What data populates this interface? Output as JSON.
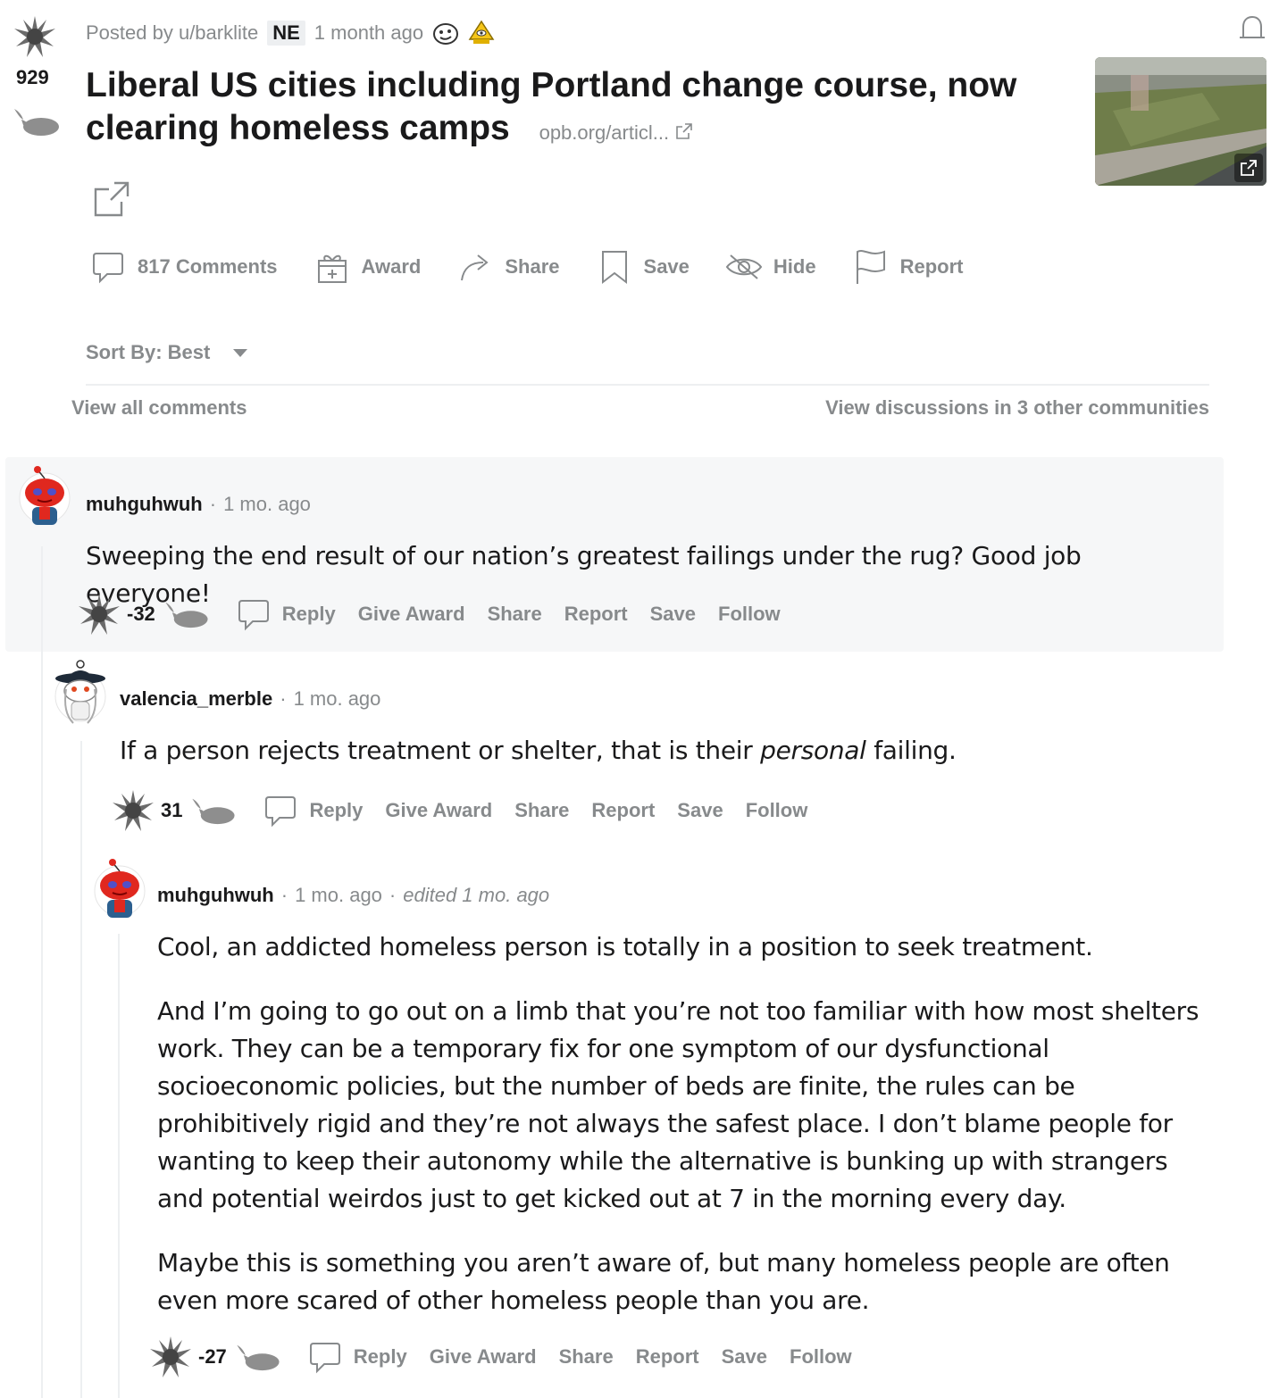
{
  "post": {
    "score": "929",
    "posted_by": "Posted by u/barklite",
    "flair": "NE",
    "time": "1 month ago",
    "title": "Liberal US cities including Portland change course, now clearing homeless camps",
    "domain": "opb.org/articl...",
    "icons": {
      "upvote": "burst-upvote-icon",
      "downvote": "whale-downvote-icon",
      "bell": "bell-icon",
      "expand": "external-link-icon"
    }
  },
  "actions": {
    "comments": "817 Comments",
    "award": "Award",
    "share": "Share",
    "save": "Save",
    "hide": "Hide",
    "report": "Report"
  },
  "sort": {
    "label": "Sort By: Best"
  },
  "links": {
    "view_all": "View all comments",
    "view_discussions": "View discussions in 3 other communities"
  },
  "comment_actions": {
    "reply": "Reply",
    "give_award": "Give Award",
    "share": "Share",
    "report": "Report",
    "save": "Save",
    "follow": "Follow"
  },
  "comments": [
    {
      "user": "muhguhwuh",
      "time": "1 mo. ago",
      "body": [
        "Sweeping the end result of our nation’s greatest failings under the rug? Good job everyone!"
      ],
      "score": "-32"
    },
    {
      "user": "valencia_merble",
      "time": "1 mo. ago",
      "body_pre": "If a person rejects treatment or shelter, that is their ",
      "body_em": "personal",
      "body_post": " failing.",
      "score": "31"
    },
    {
      "user": "muhguhwuh",
      "time": "1 mo. ago",
      "edited": "edited 1 mo. ago",
      "body": [
        "Cool, an addicted homeless person is totally in a position to seek treatment.",
        "And I’m going to go out on a limb that you’re not too familiar with how most shelters work. They can be a temporary fix for one symptom of our dysfunctional socioeconomic policies, but the number of beds are finite, the rules can be prohibitively rigid and they’re not always the safest place. I don’t blame people for wanting to keep their autonomy while the alternative is bunking up with strangers and potential weirdos just to get kicked out at 7 in the morning every day.",
        "Maybe this is something you aren’t aware of, but many homeless people are often even more scared of other homeless people than you are."
      ],
      "score": "-27"
    }
  ],
  "colors": {
    "meta_gray": "#878a8c",
    "text": "#1a1a1b",
    "highlight_bg": "#f6f7f8",
    "divider": "#edeff1"
  }
}
